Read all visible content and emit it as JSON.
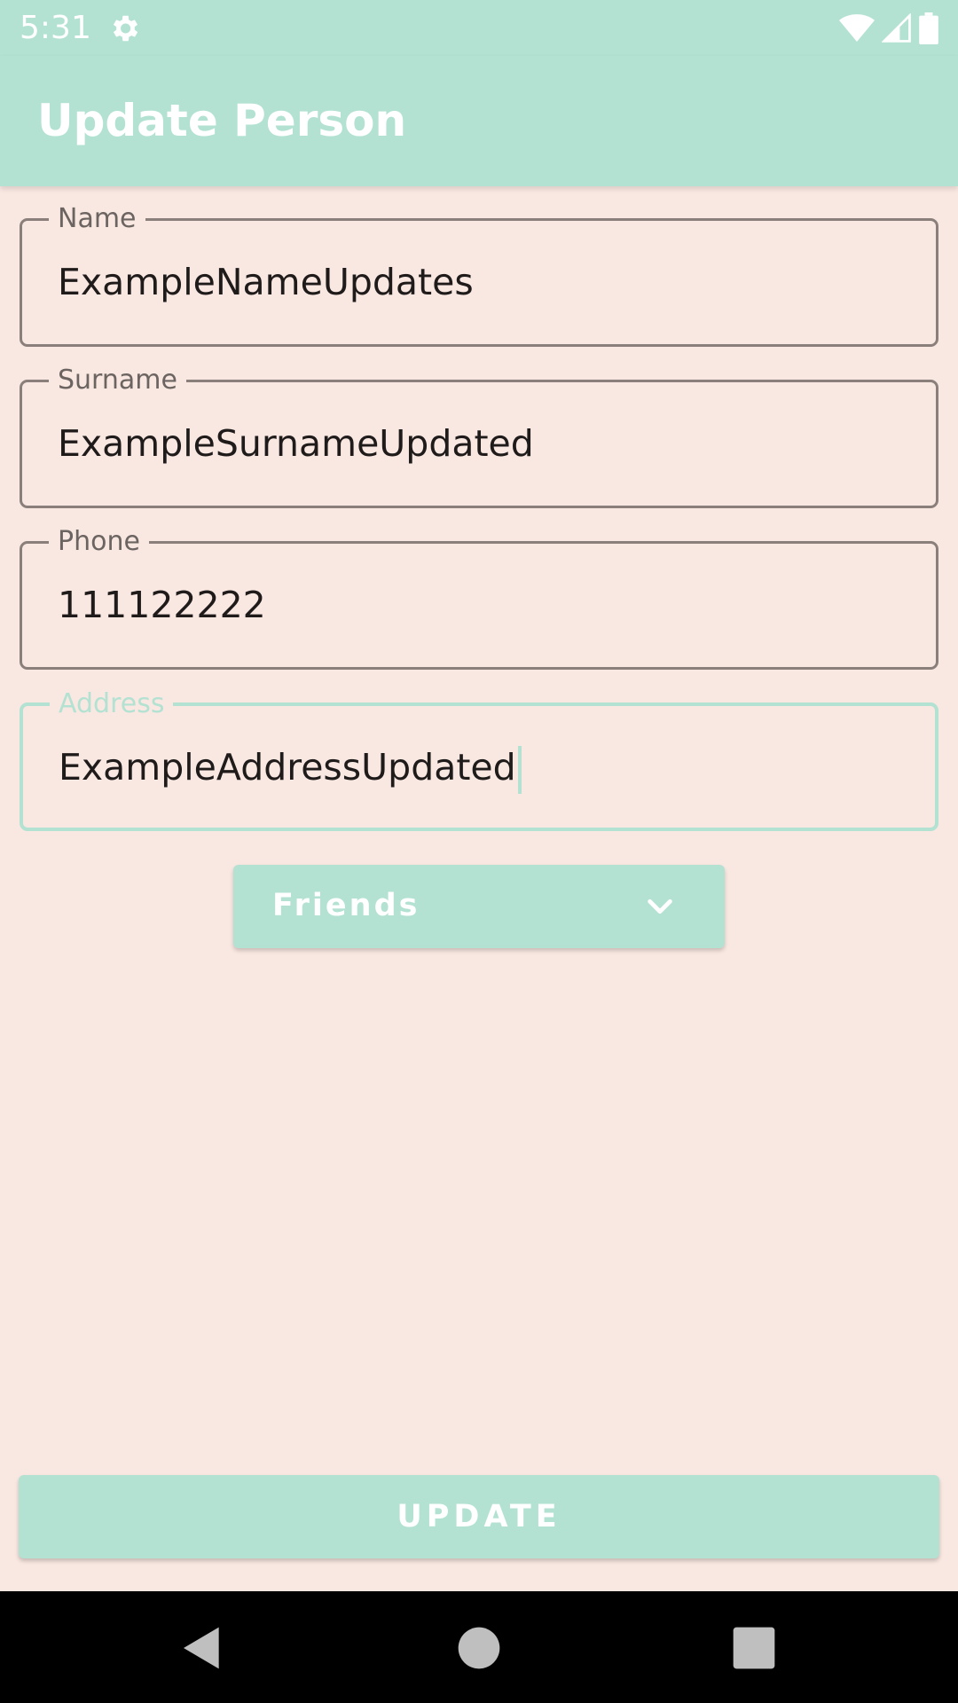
{
  "status_bar": {
    "time": "5:31",
    "icons": [
      "settings-gear-icon",
      "wifi-icon",
      "cell-signal-icon",
      "battery-icon"
    ]
  },
  "app_bar": {
    "title": "Update Person"
  },
  "form": {
    "name": {
      "label": "Name",
      "value": "ExampleNameUpdates"
    },
    "surname": {
      "label": "Surname",
      "value": "ExampleSurnameUpdated"
    },
    "phone": {
      "label": "Phone",
      "value": "111122222"
    },
    "address": {
      "label": "Address",
      "value": "ExampleAddressUpdated",
      "focused": true
    }
  },
  "spinner": {
    "selected": "Friends",
    "icon": "chevron-down-icon"
  },
  "actions": {
    "update_label": "UPDATE"
  },
  "nav": {
    "icons": [
      "back-icon",
      "home-icon",
      "recents-icon"
    ]
  },
  "colors": {
    "accent": "#b3e2d3",
    "background": "#f9e7e1",
    "outline": "#8a7f7b",
    "text": "#1e1b1a"
  }
}
